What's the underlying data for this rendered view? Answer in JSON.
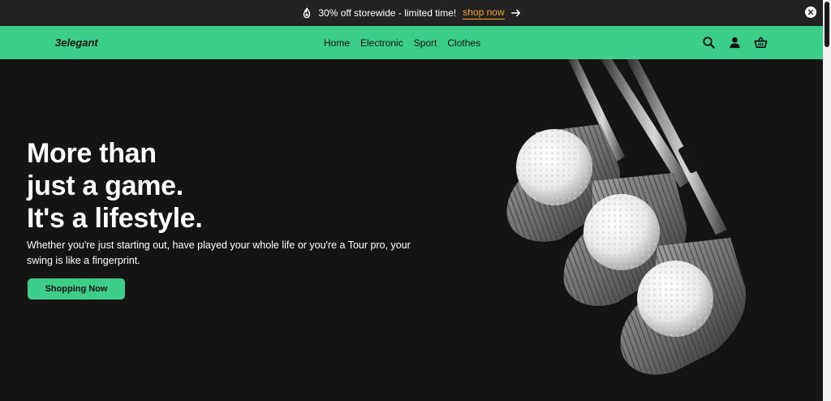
{
  "announcement": {
    "text": "30% off storewide - limited time!",
    "link": "shop now",
    "icons": [
      "fire-icon",
      "arrow-right-icon",
      "close-icon"
    ]
  },
  "navbar": {
    "logo": "3elegant",
    "links": [
      "Home",
      "Electronic",
      "Sport",
      "Clothes"
    ],
    "icons": [
      "search-icon",
      "user-icon",
      "basket-icon"
    ]
  },
  "hero": {
    "title_lines": [
      "More than",
      "just a game.",
      "It's a lifestyle."
    ],
    "subtitle": "Whether you're just starting out, have played your whole life or you're a Tour pro, your swing is like a fingerprint.",
    "cta": "Shopping Now"
  },
  "colors": {
    "accent": "#3ccd8b",
    "announce_bg": "#222222",
    "hero_bg": "#141414",
    "link": "#f5a623"
  }
}
